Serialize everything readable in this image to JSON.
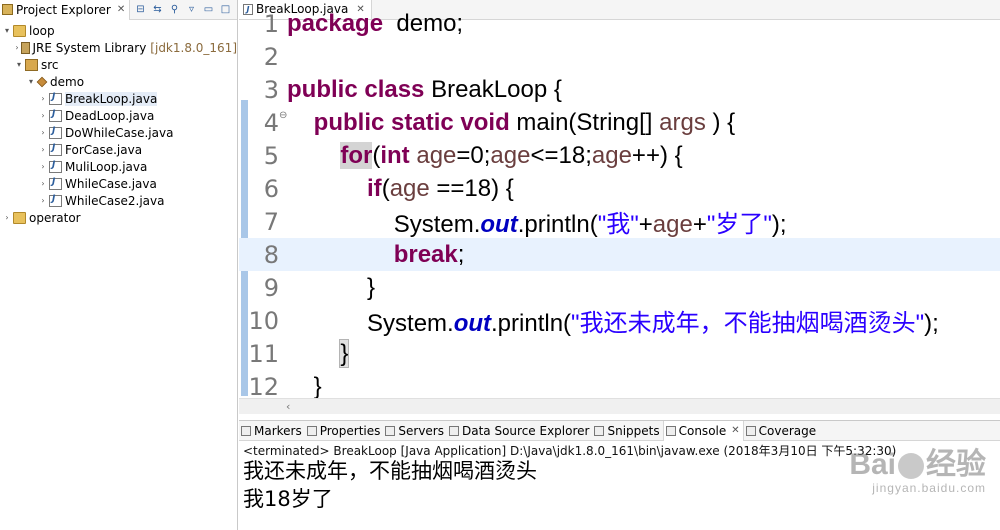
{
  "explorer": {
    "title": "Project Explorer",
    "tree": [
      {
        "label": "loop",
        "arrow": "expanded",
        "icon": "project-icon",
        "indent": 0
      },
      {
        "label": "JRE System Library",
        "extra": "[jdk1.8.0_161]",
        "arrow": "collapsed",
        "icon": "library-icon",
        "indent": 1
      },
      {
        "label": "src",
        "arrow": "expanded",
        "icon": "source-folder-icon",
        "indent": 1
      },
      {
        "label": "demo",
        "arrow": "expanded",
        "icon": "package-icon",
        "indent": 2
      },
      {
        "label": "BreakLoop.java",
        "arrow": "collapsed",
        "icon": "java-file-icon",
        "indent": 3,
        "selected": true
      },
      {
        "label": "DeadLoop.java",
        "arrow": "collapsed",
        "icon": "java-file-icon",
        "indent": 3
      },
      {
        "label": "DoWhileCase.java",
        "arrow": "collapsed",
        "icon": "java-file-icon",
        "indent": 3
      },
      {
        "label": "ForCase.java",
        "arrow": "collapsed",
        "icon": "java-file-icon",
        "indent": 3
      },
      {
        "label": "MuliLoop.java",
        "arrow": "collapsed",
        "icon": "java-file-icon",
        "indent": 3
      },
      {
        "label": "WhileCase.java",
        "arrow": "collapsed",
        "icon": "java-file-icon",
        "indent": 3
      },
      {
        "label": "WhileCase2.java",
        "arrow": "collapsed",
        "icon": "java-file-icon",
        "indent": 3
      },
      {
        "label": "operator",
        "arrow": "collapsed",
        "icon": "project-icon",
        "indent": 0
      }
    ]
  },
  "editor": {
    "tab_title": "BreakLoop.java",
    "lines": [
      {
        "n": "1",
        "tokens": [
          [
            "kw",
            "package"
          ],
          [
            "",
            "  demo;"
          ]
        ]
      },
      {
        "n": "2",
        "tokens": []
      },
      {
        "n": "3",
        "tokens": [
          [
            "kw",
            "public"
          ],
          [
            "",
            " "
          ],
          [
            "kw",
            "class"
          ],
          [
            "",
            " BreakLoop {"
          ]
        ]
      },
      {
        "n": "4",
        "fold": true,
        "tokens": [
          [
            "",
            "    "
          ],
          [
            "kw",
            "public"
          ],
          [
            "",
            " "
          ],
          [
            "kw",
            "static"
          ],
          [
            "",
            " "
          ],
          [
            "kw",
            "void"
          ],
          [
            "",
            " main(String[] "
          ],
          [
            "var",
            "args"
          ],
          [
            "",
            " ) {"
          ]
        ]
      },
      {
        "n": "5",
        "tokens": [
          [
            "",
            "        "
          ],
          [
            "kw hl",
            "for"
          ],
          [
            "",
            "("
          ],
          [
            "kw",
            "int"
          ],
          [
            "",
            " "
          ],
          [
            "var",
            "age"
          ],
          [
            "",
            "=0;"
          ],
          [
            "var",
            "age"
          ],
          [
            "",
            "<=18;"
          ],
          [
            "var",
            "age"
          ],
          [
            "",
            "++) {"
          ]
        ]
      },
      {
        "n": "6",
        "tokens": [
          [
            "",
            "            "
          ],
          [
            "kw",
            "if"
          ],
          [
            "",
            "("
          ],
          [
            "var",
            "age"
          ],
          [
            "",
            " ==18) {"
          ]
        ]
      },
      {
        "n": "7",
        "tokens": [
          [
            "",
            "                System."
          ],
          [
            "fld",
            "out"
          ],
          [
            "",
            ".println("
          ],
          [
            "str",
            "\"我\""
          ],
          [
            "",
            "+"
          ],
          [
            "var",
            "age"
          ],
          [
            "",
            "+"
          ],
          [
            "str",
            "\"岁了\""
          ],
          [
            "",
            ");"
          ]
        ]
      },
      {
        "n": "8",
        "current": true,
        "tokens": [
          [
            "",
            "                "
          ],
          [
            "kw",
            "break"
          ],
          [
            "",
            ";"
          ]
        ]
      },
      {
        "n": "9",
        "tokens": [
          [
            "",
            "            }"
          ]
        ]
      },
      {
        "n": "10",
        "tokens": [
          [
            "",
            "            System."
          ],
          [
            "fld",
            "out"
          ],
          [
            "",
            ".println("
          ],
          [
            "str",
            "\"我还未成年，不能抽烟喝酒烫头\""
          ],
          [
            "",
            ");"
          ]
        ]
      },
      {
        "n": "11",
        "tokens": [
          [
            "",
            "        "
          ],
          [
            "brk-hl",
            "}"
          ]
        ]
      },
      {
        "n": "12",
        "tokens": [
          [
            "",
            "    }"
          ]
        ]
      }
    ]
  },
  "bottom": {
    "tabs": [
      {
        "label": "Markers",
        "active": false
      },
      {
        "label": "Properties",
        "active": false
      },
      {
        "label": "Servers",
        "active": false
      },
      {
        "label": "Data Source Explorer",
        "active": false
      },
      {
        "label": "Snippets",
        "active": false
      },
      {
        "label": "Console",
        "active": true
      },
      {
        "label": "Coverage",
        "active": false
      }
    ],
    "status": "<terminated> BreakLoop [Java Application] D:\\Java\\jdk1.8.0_161\\bin\\javaw.exe (2018年3月10日 下午5:32:30)",
    "output": [
      "我还未成年，不能抽烟喝酒烫头",
      "我18岁了"
    ]
  },
  "watermark": {
    "brand": "Bai",
    "brand2": "经验",
    "url": "jingyan.baidu.com"
  }
}
